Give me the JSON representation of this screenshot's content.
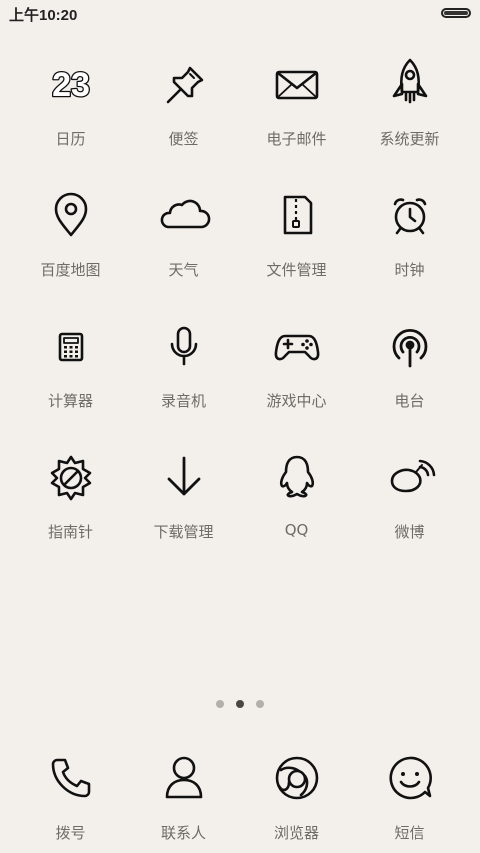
{
  "status": {
    "time": "上午10:20",
    "battery_level": 1.0
  },
  "apps": [
    {
      "label": "日历",
      "icon": "calendar-icon",
      "date_number": "23"
    },
    {
      "label": "便签",
      "icon": "pin-icon"
    },
    {
      "label": "电子邮件",
      "icon": "envelope-icon"
    },
    {
      "label": "系统更新",
      "icon": "rocket-icon"
    },
    {
      "label": "百度地图",
      "icon": "map-pin-icon"
    },
    {
      "label": "天气",
      "icon": "cloud-icon"
    },
    {
      "label": "文件管理",
      "icon": "zip-file-icon"
    },
    {
      "label": "时钟",
      "icon": "alarm-clock-icon"
    },
    {
      "label": "计算器",
      "icon": "calculator-icon"
    },
    {
      "label": "录音机",
      "icon": "microphone-icon"
    },
    {
      "label": "游戏中心",
      "icon": "gamepad-icon"
    },
    {
      "label": "电台",
      "icon": "radio-icon"
    },
    {
      "label": "指南针",
      "icon": "compass-icon"
    },
    {
      "label": "下载管理",
      "icon": "download-arrow-icon"
    },
    {
      "label": "QQ",
      "icon": "penguin-icon"
    },
    {
      "label": "微博",
      "icon": "weibo-icon"
    }
  ],
  "page_indicator": {
    "pages": 3,
    "current": 2
  },
  "dock": [
    {
      "label": "拨号",
      "icon": "phone-icon"
    },
    {
      "label": "联系人",
      "icon": "person-icon"
    },
    {
      "label": "浏览器",
      "icon": "browser-icon"
    },
    {
      "label": "短信",
      "icon": "smiley-chat-icon"
    }
  ],
  "colors": {
    "background": "#f3f0ec",
    "label": "#6f6b66",
    "icon_stroke": "#111111",
    "dot_inactive": "#b3afaa",
    "dot_active": "#4a4743"
  }
}
